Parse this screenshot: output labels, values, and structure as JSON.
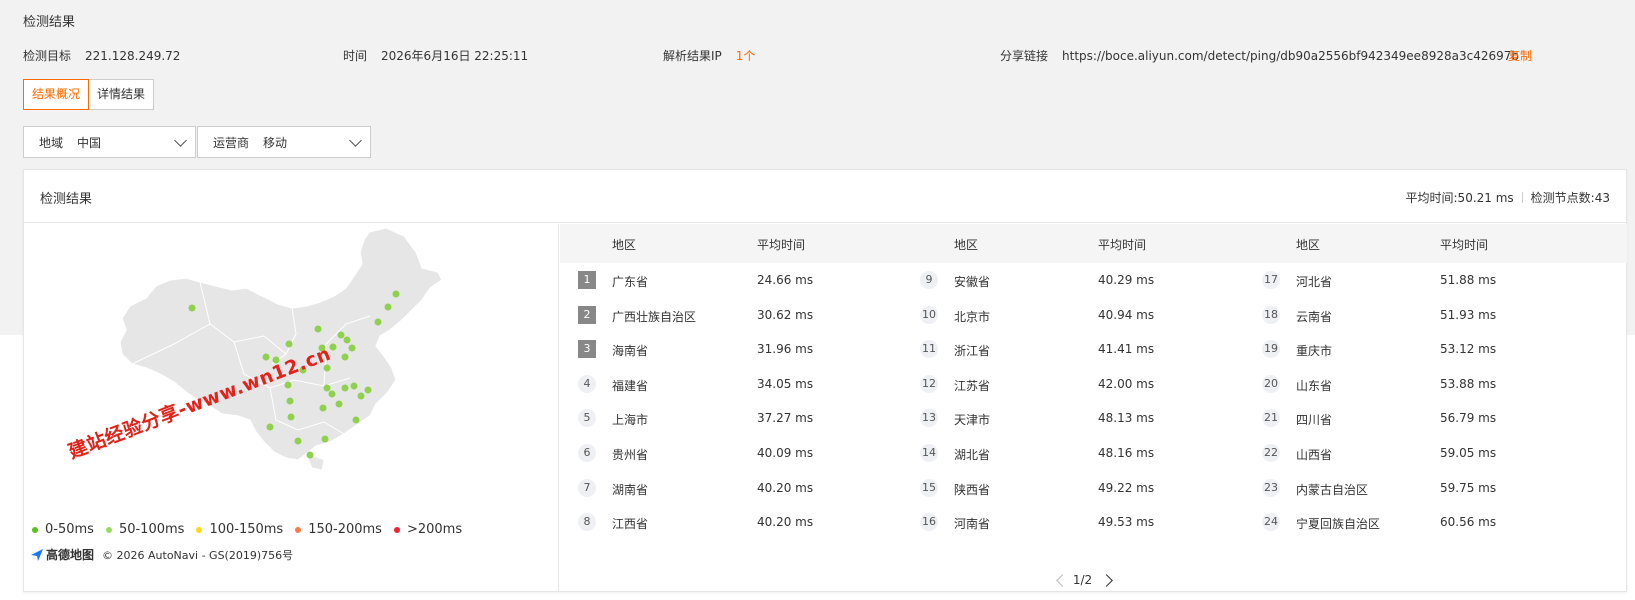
{
  "page_title": "检测结果",
  "meta": {
    "target_label": "检测目标",
    "target_value": "221.128.249.72",
    "time_label": "时间",
    "time_value": "2026年6月16日 22:25:11",
    "ip_label": "解析结果IP",
    "ip_value": "1个",
    "share_label": "分享链接",
    "share_value": "https://boce.aliyun.com/detect/ping/db90a2556bf942349ee8928a3c42697b",
    "copy_label": "复制"
  },
  "tabs": [
    {
      "label": "结果概况",
      "active": true
    },
    {
      "label": "详情结果",
      "active": false
    }
  ],
  "filters": {
    "region_label": "地域",
    "region_value": "中国",
    "isp_label": "运营商",
    "isp_value": "移动"
  },
  "card": {
    "title": "检测结果",
    "avg_time": "平均时间:50.21 ms",
    "node_count": "检测节点数:43"
  },
  "table": {
    "headers": {
      "region": "地区",
      "time": "平均时间"
    },
    "rows": [
      {
        "rank": "1",
        "region": "广东省",
        "time": "24.66 ms"
      },
      {
        "rank": "2",
        "region": "广西壮族自治区",
        "time": "30.62 ms"
      },
      {
        "rank": "3",
        "region": "海南省",
        "time": "31.96 ms"
      },
      {
        "rank": "4",
        "region": "福建省",
        "time": "34.05 ms"
      },
      {
        "rank": "5",
        "region": "上海市",
        "time": "37.27 ms"
      },
      {
        "rank": "6",
        "region": "贵州省",
        "time": "40.09 ms"
      },
      {
        "rank": "7",
        "region": "湖南省",
        "time": "40.20 ms"
      },
      {
        "rank": "8",
        "region": "江西省",
        "time": "40.20 ms"
      },
      {
        "rank": "9",
        "region": "安徽省",
        "time": "40.29 ms"
      },
      {
        "rank": "10",
        "region": "北京市",
        "time": "40.94 ms"
      },
      {
        "rank": "11",
        "region": "浙江省",
        "time": "41.41 ms"
      },
      {
        "rank": "12",
        "region": "江苏省",
        "time": "42.00 ms"
      },
      {
        "rank": "13",
        "region": "天津市",
        "time": "48.13 ms"
      },
      {
        "rank": "14",
        "region": "湖北省",
        "time": "48.16 ms"
      },
      {
        "rank": "15",
        "region": "陕西省",
        "time": "49.22 ms"
      },
      {
        "rank": "16",
        "region": "河南省",
        "time": "49.53 ms"
      },
      {
        "rank": "17",
        "region": "河北省",
        "time": "51.88 ms"
      },
      {
        "rank": "18",
        "region": "云南省",
        "time": "51.93 ms"
      },
      {
        "rank": "19",
        "region": "重庆市",
        "time": "53.12 ms"
      },
      {
        "rank": "20",
        "region": "山东省",
        "time": "53.88 ms"
      },
      {
        "rank": "21",
        "region": "四川省",
        "time": "56.79 ms"
      },
      {
        "rank": "22",
        "region": "山西省",
        "time": "59.05 ms"
      },
      {
        "rank": "23",
        "region": "内蒙古自治区",
        "time": "59.75 ms"
      },
      {
        "rank": "24",
        "region": "宁夏回族自治区",
        "time": "60.56 ms"
      }
    ]
  },
  "pagination": {
    "text": "1/2"
  },
  "legend": [
    {
      "label": "0-50ms",
      "color": "#52c41a"
    },
    {
      "label": "50-100ms",
      "color": "#95de64"
    },
    {
      "label": "100-150ms",
      "color": "#fadb14"
    },
    {
      "label": "150-200ms",
      "color": "#ff7a45"
    },
    {
      "label": ">200ms",
      "color": "#f5222d"
    }
  ],
  "map": {
    "logo_text": "高德地图",
    "copyright": "© 2026 AutoNavi - GS(2019)756号",
    "marker_color": "#8fd14f"
  },
  "watermark": "建站经验分享-www.wn12.cn"
}
